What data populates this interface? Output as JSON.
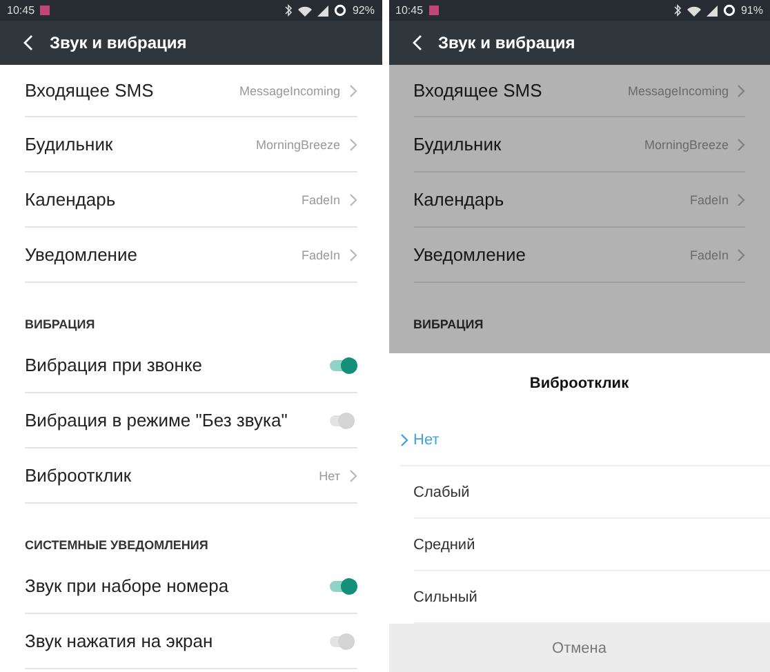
{
  "screens": [
    {
      "status_bar": {
        "time": "10:45",
        "battery": "92%"
      },
      "header": {
        "title": "Звук и вибрация"
      },
      "dimmed": false,
      "sections": [
        {
          "items": [
            {
              "kind": "link",
              "label": "Входящее SMS",
              "value": "MessageIncoming"
            },
            {
              "kind": "link",
              "label": "Будильник",
              "value": "MorningBreeze"
            },
            {
              "kind": "link",
              "label": "Календарь",
              "value": "FadeIn"
            },
            {
              "kind": "link",
              "label": "Уведомление",
              "value": "FadeIn"
            }
          ]
        },
        {
          "title": "ВИБРАЦИЯ",
          "items": [
            {
              "kind": "toggle",
              "label": "Вибрация при звонке",
              "on": true
            },
            {
              "kind": "toggle",
              "label": "Вибрация в режиме \"Без звука\"",
              "on": false
            },
            {
              "kind": "link",
              "label": "Виброотклик",
              "value": "Нет"
            }
          ]
        },
        {
          "title": "СИСТЕМНЫЕ УВЕДОМЛЕНИЯ",
          "items": [
            {
              "kind": "toggle",
              "label": "Звук при наборе номера",
              "on": true
            },
            {
              "kind": "toggle",
              "label": "Звук нажатия на экран",
              "on": false
            }
          ]
        }
      ]
    },
    {
      "status_bar": {
        "time": "10:45",
        "battery": "91%"
      },
      "header": {
        "title": "Звук и вибрация"
      },
      "dimmed": true,
      "sections": [
        {
          "items": [
            {
              "kind": "link",
              "label": "Входящее SMS",
              "value": "MessageIncoming"
            },
            {
              "kind": "link",
              "label": "Будильник",
              "value": "MorningBreeze"
            },
            {
              "kind": "link",
              "label": "Календарь",
              "value": "FadeIn"
            },
            {
              "kind": "link",
              "label": "Уведомление",
              "value": "FadeIn"
            }
          ]
        },
        {
          "title": "ВИБРАЦИЯ"
        }
      ],
      "sheet": {
        "title": "Виброотклик",
        "options": [
          {
            "label": "Нет",
            "selected": true
          },
          {
            "label": "Слабый",
            "selected": false
          },
          {
            "label": "Средний",
            "selected": false
          },
          {
            "label": "Сильный",
            "selected": false
          }
        ],
        "cancel": "Отмена"
      }
    }
  ]
}
